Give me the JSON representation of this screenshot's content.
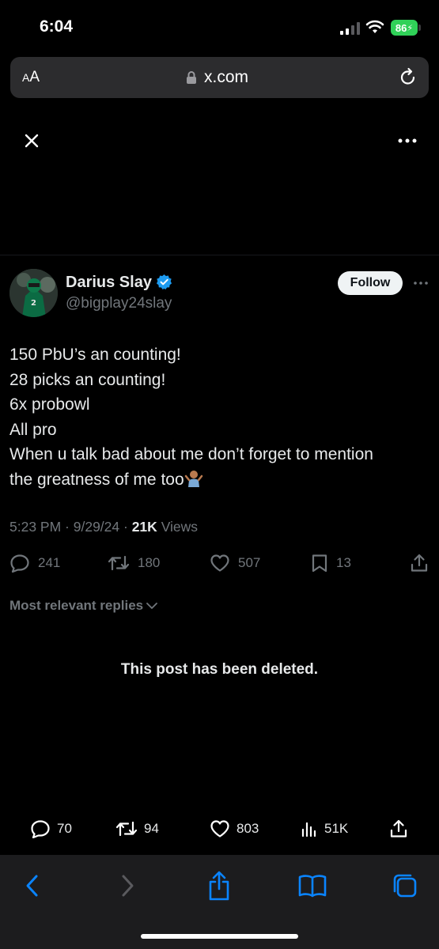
{
  "status_bar": {
    "time": "6:04",
    "battery": "86"
  },
  "browser": {
    "text_size_small": "A",
    "text_size_large": "A",
    "url": "x.com"
  },
  "tweet": {
    "author_name": "Darius Slay",
    "handle": "@bigplay24slay",
    "follow_label": "Follow",
    "text_lines": [
      "150 PbU’s an counting!",
      "28 picks an counting!",
      "6x probowl",
      "All pro",
      "When u talk bad about me don’t forget to mention",
      "the greatness of me too"
    ],
    "time": "5:23 PM",
    "date": "9/29/24",
    "views": "21K",
    "views_label": "Views",
    "replies": "241",
    "reposts": "180",
    "likes": "507",
    "bookmarks": "13"
  },
  "replies_section": {
    "sort_label": "Most relevant replies",
    "deleted_notice": "This post has been deleted."
  },
  "overlay_actions": {
    "replies": "70",
    "reposts": "94",
    "likes": "803",
    "views": "51K"
  },
  "colors": {
    "background": "#000000",
    "accent": "#1d9bf0",
    "safari_blue": "#0a84ff",
    "battery": "#30d158"
  },
  "icons": [
    "close-icon",
    "more-icon",
    "verified-icon",
    "reply-icon",
    "repost-icon",
    "like-icon",
    "bookmark-icon",
    "share-icon",
    "views-icon",
    "back-icon",
    "forward-icon",
    "safari-share-icon",
    "bookmarks-book-icon",
    "tabs-icon"
  ]
}
